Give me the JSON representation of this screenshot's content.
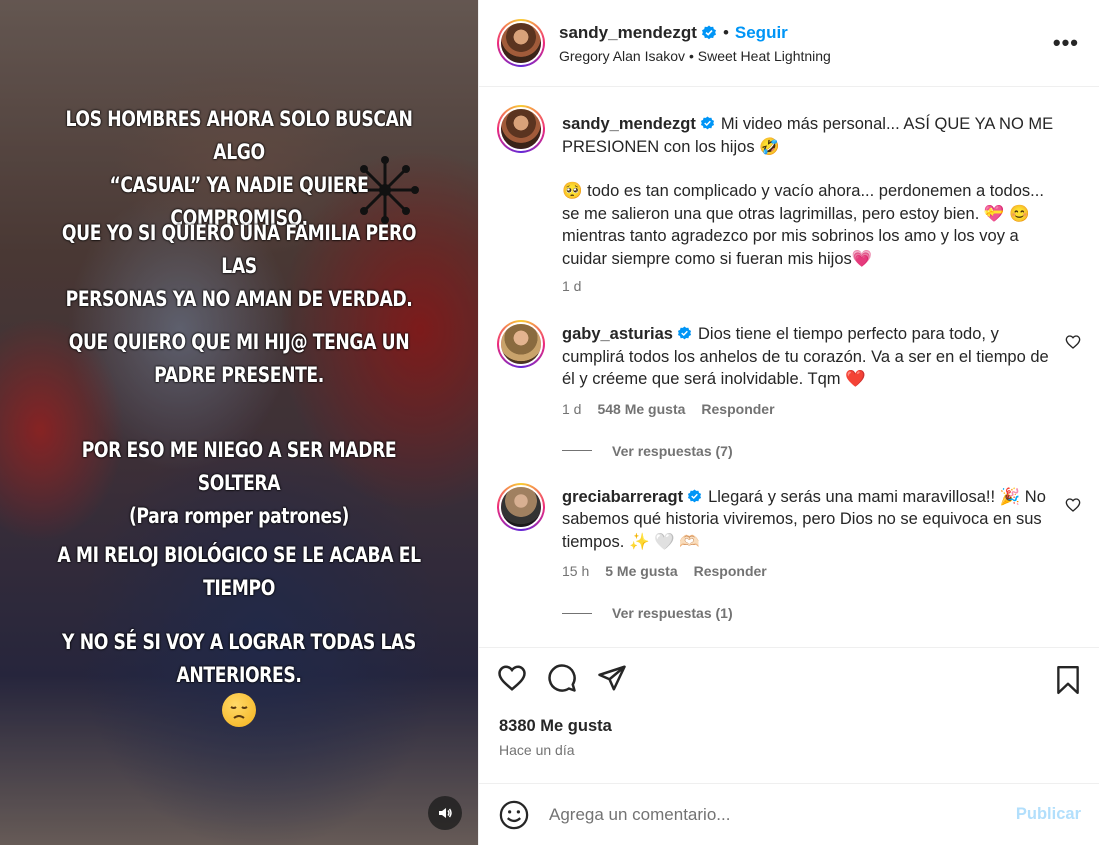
{
  "media": {
    "overlay_lines": [
      "LOS HOMBRES AHORA SOLO BUSCAN ALGO",
      "“CASUAL” YA NADIE QUIERE COMPROMISO.",
      "QUE YO SI QUIERO UNA FAMILIA PERO LAS",
      "PERSONAS YA NO AMAN DE VERDAD.",
      "QUE QUIERO QUE MI HIJ@ TENGA UN",
      "PADRE PRESENTE.",
      "POR ESO ME NIEGO A SER MADRE SOLTERA",
      "(Para romper patrones)",
      "A MI RELOJ BIOLÓGICO SE LE ACABA EL",
      "TIEMPO",
      "Y NO SÉ SI VOY A LOGRAR TODAS LAS",
      "ANTERIORES."
    ],
    "sad_emoji_icon": "sad-face-icon",
    "sound_icon": "speaker-icon"
  },
  "header": {
    "username": "sandy_mendezgt",
    "separator": "•",
    "follow_label": "Seguir",
    "audio_artist": "Gregory Alan Isakov",
    "audio_sep": " • ",
    "audio_track": "Sweet Heat Lightning",
    "more_label": "•••"
  },
  "caption": {
    "username": "sandy_mendezgt",
    "text_1": "Mi video más personal... ASÍ QUE YA NO ME PRESIONEN con los hijos 🤣",
    "text_2": "🥺 todo es tan complicado y vacío ahora... perdonemen a todos... se me salieron una que otras lagrimillas, pero estoy bien. 💝 😊 mientras tanto agradezco por mis sobrinos los amo y los voy a cuidar siempre como si fueran mis hijos💗",
    "time": "1 d"
  },
  "comments": [
    {
      "username": "gaby_asturias",
      "text": "Dios tiene el tiempo perfecto para todo, y cumplirá todos los anhelos de tu corazón. Va a ser en el tiempo de él y créeme que será inolvidable. Tqm",
      "emoji": "❤️",
      "time": "1 d",
      "likes": "548 Me gusta",
      "reply_label": "Responder",
      "view_replies": "Ver respuestas (7)"
    },
    {
      "username": "greciabarreragt",
      "text": "Llegará y serás una mami maravillosa!! 🎉 No sabemos qué historia viviremos, pero Dios no se equivoca en sus tiempos. ✨ 🤍 🫶🏻",
      "time": "15 h",
      "likes": "5 Me gusta",
      "reply_label": "Responder",
      "view_replies": "Ver respuestas (1)"
    }
  ],
  "actions": {
    "likes": "8380 Me gusta",
    "time_ago": "Hace un día"
  },
  "add_comment": {
    "placeholder": "Agrega un comentario...",
    "post_label": "Publicar"
  },
  "colors": {
    "accent_blue": "#0095f6",
    "post_disabled": "#b2dffc",
    "like_red": "#ff3040",
    "meta_gray": "#737373"
  }
}
